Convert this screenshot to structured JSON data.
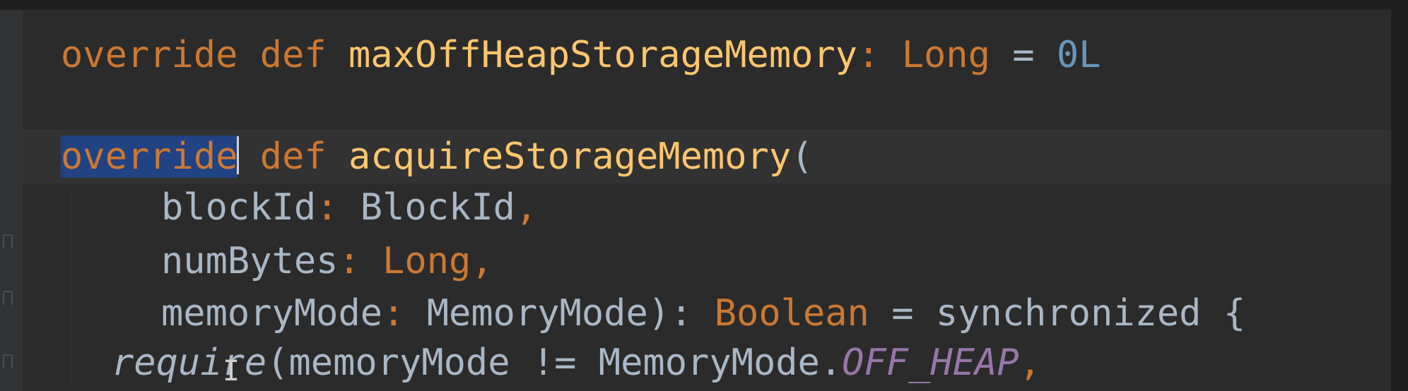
{
  "editor": {
    "lines": [
      {
        "id": "line1",
        "tokens": {
          "kw_override": "override",
          "kw_def": "def",
          "fn_name": "maxOffHeapStorageMemory",
          "colon": ":",
          "type": "Long",
          "eq": "=",
          "value": "0L"
        }
      },
      {
        "id": "line2",
        "tokens": {
          "kw_override": "override",
          "kw_def": "def",
          "fn_name": "acquireStorageMemory",
          "paren": "("
        }
      },
      {
        "id": "line3",
        "tokens": {
          "param": "blockId",
          "colon": ":",
          "type": "BlockId",
          "comma": ","
        }
      },
      {
        "id": "line4",
        "tokens": {
          "param": "numBytes",
          "colon": ":",
          "type": "Long",
          "comma": ","
        }
      },
      {
        "id": "line5",
        "tokens": {
          "param": "memoryMode",
          "colon": ":",
          "type": "MemoryMode",
          "close": "):",
          "ret_type": "Boolean",
          "eq": "=",
          "sync": "synchronized",
          "brace": "{"
        }
      },
      {
        "id": "line6",
        "tokens": {
          "fn": "require",
          "open": "(",
          "arg": "memoryMode",
          "op": "!=",
          "enum": "MemoryMode.",
          "const": "OFF_HEAP",
          "comma": ","
        }
      }
    ]
  },
  "colors": {
    "background": "#2b2b2b",
    "keyword": "#cc7832",
    "function": "#ffc66d",
    "number": "#6897bb",
    "text": "#a9b7c6",
    "constant": "#9876aa",
    "selection": "#214283"
  }
}
